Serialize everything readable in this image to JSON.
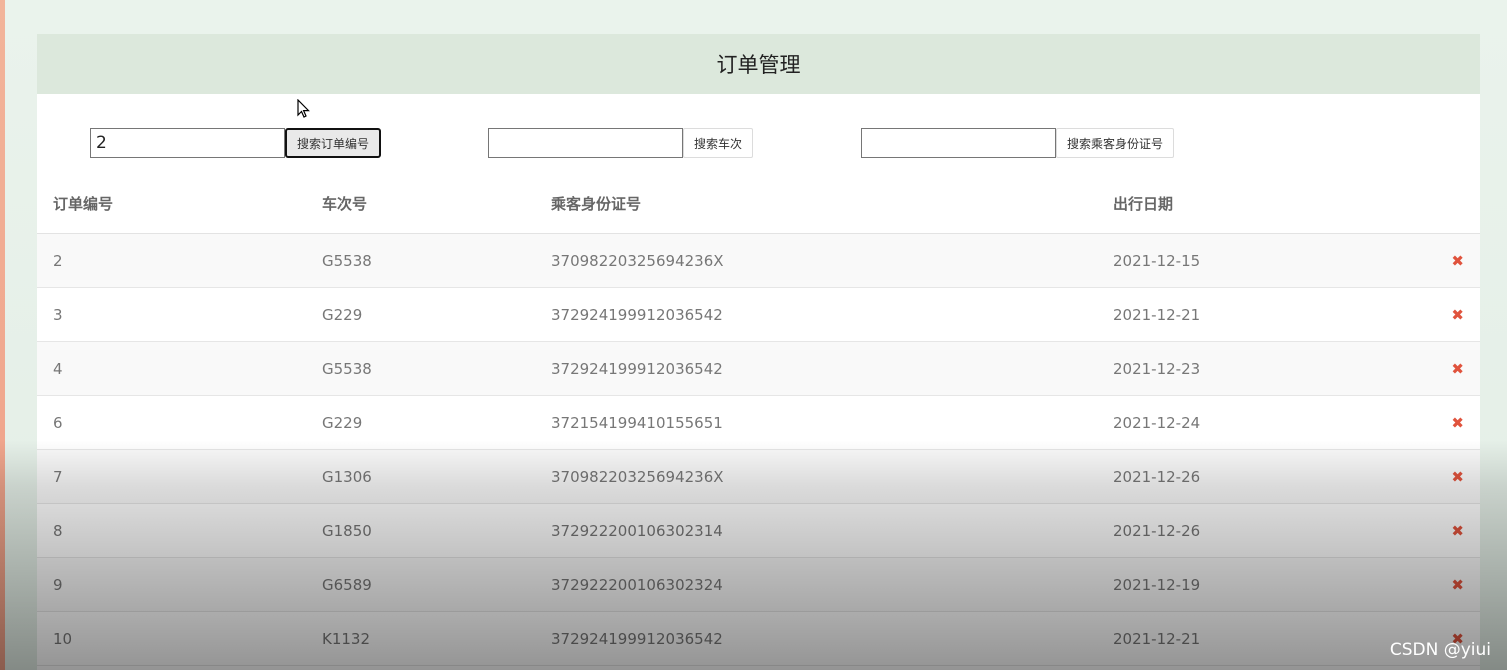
{
  "header": {
    "title": "订单管理"
  },
  "search": [
    {
      "value": "2",
      "button": "搜索订单编号"
    },
    {
      "value": "",
      "button": "搜索车次"
    },
    {
      "value": "",
      "button": "搜索乘客身份证号"
    }
  ],
  "table": {
    "columns": [
      "订单编号",
      "车次号",
      "乘客身份证号",
      "出行日期"
    ],
    "rows": [
      {
        "id": "2",
        "train": "G5538",
        "passenger_id": "37098220325694236X",
        "date": "2021-12-15"
      },
      {
        "id": "3",
        "train": "G229",
        "passenger_id": "372924199912036542",
        "date": "2021-12-21"
      },
      {
        "id": "4",
        "train": "G5538",
        "passenger_id": "372924199912036542",
        "date": "2021-12-23"
      },
      {
        "id": "6",
        "train": "G229",
        "passenger_id": "372154199410155651",
        "date": "2021-12-24"
      },
      {
        "id": "7",
        "train": "G1306",
        "passenger_id": "37098220325694236X",
        "date": "2021-12-26"
      },
      {
        "id": "8",
        "train": "G1850",
        "passenger_id": "372922200106302314",
        "date": "2021-12-26"
      },
      {
        "id": "9",
        "train": "G6589",
        "passenger_id": "372922200106302324",
        "date": "2021-12-19"
      },
      {
        "id": "10",
        "train": "K1132",
        "passenger_id": "372924199912036542",
        "date": "2021-12-21"
      }
    ],
    "delete_icon": "✖"
  },
  "watermark": "CSDN @yiui",
  "colors": {
    "header_bg": "#dce8dc",
    "delete": "#e0533d",
    "accent_edge": "#f2b49a"
  }
}
